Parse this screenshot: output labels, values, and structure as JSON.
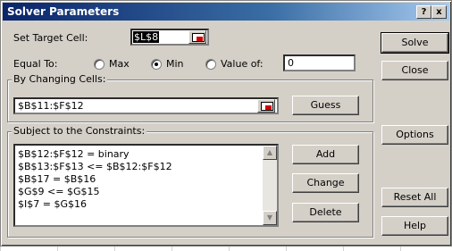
{
  "window": {
    "title": "Solver Parameters",
    "help_btn": "?",
    "close_btn": "x"
  },
  "target": {
    "label": "Set Target Cell:",
    "value": "$L$8"
  },
  "equal_to": {
    "label": "Equal To:",
    "options": [
      "Max",
      "Min",
      "Value of:"
    ],
    "selected": "Min",
    "value_of": "0"
  },
  "changing": {
    "label": "By Changing Cells:",
    "value": "$B$11:$F$12",
    "guess_btn": "Guess"
  },
  "constraints": {
    "label": "Subject to the Constraints:",
    "items": [
      "$B$12:$F$12 = binary",
      "$B$13:$F$13 <= $B$12:$F$12",
      "$B$17 = $B$16",
      "$G$9 <= $G$15",
      "$I$7 = $G$16"
    ],
    "add_btn": "Add",
    "change_btn": "Change",
    "delete_btn": "Delete"
  },
  "side_buttons": {
    "solve": "Solve",
    "close": "Close",
    "options": "Options",
    "reset_all": "Reset All",
    "help": "Help"
  }
}
